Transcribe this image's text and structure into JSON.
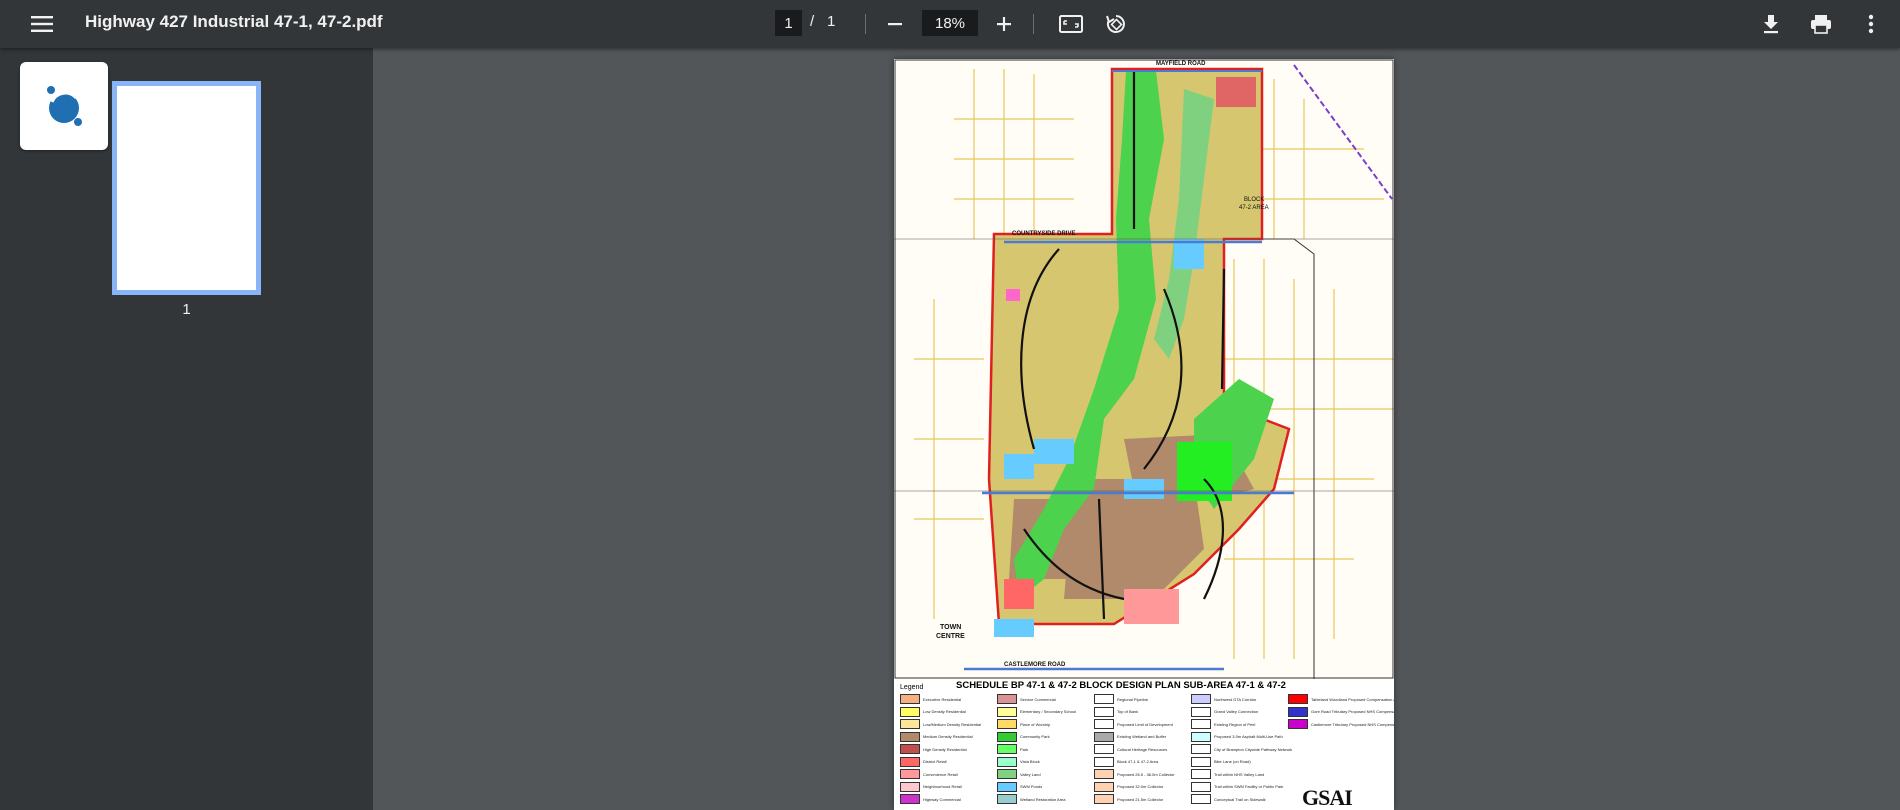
{
  "toolbar": {
    "menu_icon": "menu-icon",
    "title": "Highway 427 Industrial 47-1, 47-2.pdf",
    "current_page": "1",
    "page_separator": "/",
    "total_pages": "1",
    "zoom_out_icon": "minus-icon",
    "zoom_level": "18%",
    "zoom_in_icon": "plus-icon",
    "fit_icon": "fit-to-page-icon",
    "rotate_icon": "rotate-icon",
    "download_icon": "download-icon",
    "print_icon": "print-icon",
    "more_icon": "more-vert-icon"
  },
  "sidebar": {
    "thumbnails": [
      {
        "page_number": "1"
      }
    ]
  },
  "document": {
    "roads": {
      "mayfield": "MAYFIELD ROAD",
      "countryside": "COUNTRYSIDE DRIVE",
      "castlemore": "CASTLEMORE ROAD"
    },
    "labels": {
      "town_centre_1": "TOWN",
      "town_centre_2": "CENTRE",
      "block": "BLOCK",
      "block_area": "47-2 AREA"
    },
    "schedule_title": "SCHEDULE BP 47-1 & 47-2 BLOCK DESIGN PLAN SUB-AREA 47-1 & 47-2",
    "legend_heading": "Legend",
    "legend": [
      {
        "label": "Executive Residential",
        "color": "#f4b183"
      },
      {
        "label": "Low Density Residential",
        "color": "#ffff66"
      },
      {
        "label": "Low/Medium Density Residential",
        "color": "#ffe699"
      },
      {
        "label": "Medium Density Residential",
        "color": "#b08a6a"
      },
      {
        "label": "High Density Residential",
        "color": "#c0504d"
      },
      {
        "label": "District Retail",
        "color": "#ff6666"
      },
      {
        "label": "Convenience Retail",
        "color": "#ff9999"
      },
      {
        "label": "Neighbourhood Retail",
        "color": "#ffc7ce"
      },
      {
        "label": "Highway Commercial",
        "color": "#cc33cc"
      },
      {
        "label": "Service Commercial",
        "color": "#d99594"
      },
      {
        "label": "Elementary / Secondary School",
        "color": "#ffff99"
      },
      {
        "label": "Place of Worship",
        "color": "#ffd966"
      },
      {
        "label": "Community Park",
        "color": "#33cc33"
      },
      {
        "label": "Park",
        "color": "#66ff66"
      },
      {
        "label": "Vista Block",
        "color": "#99ffcc"
      },
      {
        "label": "Valley Land",
        "color": "#7fd17f"
      },
      {
        "label": "SWM Ponds",
        "color": "#66ccff"
      },
      {
        "label": "Wetland Restoration Area",
        "color": "#99cccc"
      },
      {
        "label": "Regional Pipeline",
        "color": "#ffffff"
      },
      {
        "label": "Top of Bank",
        "color": "#ffffff"
      },
      {
        "label": "Proposed Limit of Development",
        "color": "#ffffff"
      },
      {
        "label": "Existing Wetland and Buffer",
        "color": "#aaaaaa"
      },
      {
        "label": "Cultural Heritage Resources",
        "color": "#ffffff"
      },
      {
        "label": "Block 47-1 & 47-2 Area",
        "color": "#ffffff"
      },
      {
        "label": "Proposed 26.5 - 36.0m Collector",
        "color": "#ffd1b3"
      },
      {
        "label": "Proposed 32.0m Collector",
        "color": "#ffd1b3"
      },
      {
        "label": "Proposed 21.5m Collector",
        "color": "#ffd1b3"
      },
      {
        "label": "Northwest GTA Corridor",
        "color": "#ccccff"
      },
      {
        "label": "Grand Valley Connection",
        "color": "#ffffff"
      },
      {
        "label": "Existing Region of Peel",
        "color": "#ffffff"
      },
      {
        "label": "Proposed 3.0m Asphalt Multi-Use Path",
        "color": "#ccffff"
      },
      {
        "label": "City of Brampton Citywide Pathway Network",
        "color": "#ffffff"
      },
      {
        "label": "Bike Lane (on Road)",
        "color": "#ffffff"
      },
      {
        "label": "Trail within NHS Valley Land",
        "color": "#ffffff"
      },
      {
        "label": "Trail within SWM Facility or Public Park",
        "color": "#ffffff"
      },
      {
        "label": "Conceptual Trail on Sidewalk",
        "color": "#ffffff"
      },
      {
        "label": "Tableland Woodland Proposed Compensation Area",
        "color": "#ff0000"
      },
      {
        "label": "Gore Road Tributary Proposed NHS Compensation Area",
        "color": "#3333cc"
      },
      {
        "label": "Castlemore Tributary Proposed NHS Compensation Area",
        "color": "#cc00cc"
      }
    ],
    "logo_text": "GSAI"
  },
  "colors": {
    "toolbar_bg": "#323639",
    "viewer_bg": "#525659",
    "thumbnail_border": "#8ab4f8"
  }
}
